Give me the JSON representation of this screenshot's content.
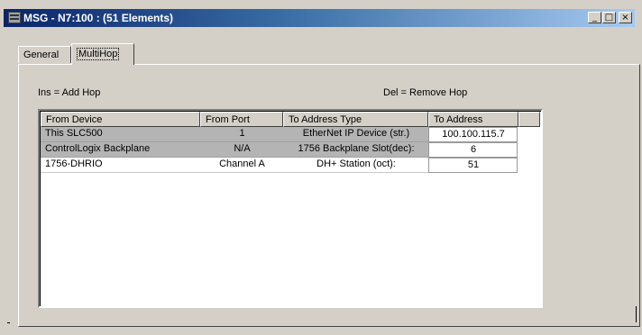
{
  "window": {
    "title": "MSG - N7:100 : (51 Elements)",
    "controls": {
      "minimize": "_",
      "maximize": "□",
      "close": "×"
    }
  },
  "tabs": [
    {
      "label": "General",
      "active": false
    },
    {
      "label": "MultiHop",
      "active": true
    }
  ],
  "hints": {
    "insert": "Ins = Add Hop",
    "delete": "Del = Remove Hop"
  },
  "table": {
    "columns": [
      "From Device",
      "From Port",
      "To Address Type",
      "To Address"
    ],
    "rows": [
      {
        "from_device": "This SLC500",
        "from_port": "1",
        "to_address_type": "EtherNet IP Device (str.)",
        "to_address": "100.100.115.7"
      },
      {
        "from_device": "ControlLogix Backplane",
        "from_port": "N/A",
        "to_address_type": "1756 Backplane Slot(dec):",
        "to_address": "6"
      },
      {
        "from_device": "1756-DHRIO",
        "from_port": "Channel A",
        "to_address_type": "DH+ Station (oct):",
        "to_address": "51"
      }
    ]
  },
  "colors": {
    "title_bar_start": "#0a246a",
    "title_bar_end": "#a6caf0",
    "selected_row": "#b4b4b4",
    "dialog_face": "#d4d0c8"
  }
}
